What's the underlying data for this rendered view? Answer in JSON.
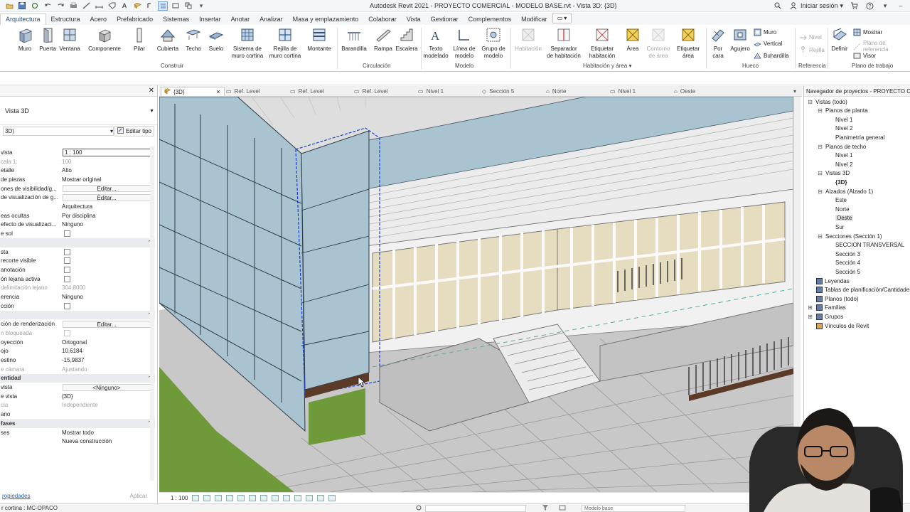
{
  "window": {
    "title": "Autodesk Revit 2021 - PROYECTO COMERCIAL - MODELO BASE.rvt - Vista 3D: {3D}",
    "sign_in": "Iniciar sesión"
  },
  "ribbon_tabs": [
    {
      "label": "Arquitectura",
      "active": true
    },
    {
      "label": "Estructura"
    },
    {
      "label": "Acero"
    },
    {
      "label": "Prefabricado"
    },
    {
      "label": "Sistemas"
    },
    {
      "label": "Insertar"
    },
    {
      "label": "Anotar"
    },
    {
      "label": "Analizar"
    },
    {
      "label": "Masa y emplazamiento"
    },
    {
      "label": "Colaborar"
    },
    {
      "label": "Vista"
    },
    {
      "label": "Gestionar"
    },
    {
      "label": "Complementos"
    },
    {
      "label": "Modificar"
    }
  ],
  "ribbon": {
    "construir": {
      "label": "Construir",
      "tools": [
        {
          "label": "Muro",
          "icon": "wall-icon"
        },
        {
          "label": "Puerta",
          "icon": "door-icon"
        },
        {
          "label": "Ventana",
          "icon": "window-icon"
        },
        {
          "label": "Componente",
          "icon": "component-icon"
        },
        {
          "label": "Pilar",
          "icon": "column-icon"
        },
        {
          "label": "Cubierta",
          "icon": "roof-icon"
        },
        {
          "label": "Techo",
          "icon": "ceiling-icon"
        },
        {
          "label": "Suelo",
          "icon": "floor-icon"
        },
        {
          "label": "Sistema de\nmuro cortina",
          "icon": "curtain-system-icon"
        },
        {
          "label": "Rejilla de\nmuro cortina",
          "icon": "curtain-grid-icon"
        },
        {
          "label": "Montante",
          "icon": "mullion-icon"
        }
      ]
    },
    "circulacion": {
      "label": "Circulación",
      "tools": [
        {
          "label": "Barandilla",
          "icon": "railing-icon"
        },
        {
          "label": "Rampa",
          "icon": "ramp-icon"
        },
        {
          "label": "Escalera",
          "icon": "stair-icon"
        }
      ]
    },
    "modelo": {
      "label": "Modelo",
      "tools": [
        {
          "label": "Texto\nmodelado",
          "icon": "model-text-icon"
        },
        {
          "label": "Línea de\nmodelo",
          "icon": "model-line-icon"
        },
        {
          "label": "Grupo de\nmodelo",
          "icon": "model-group-icon"
        }
      ]
    },
    "habitacion": {
      "label": "Habitación y área",
      "tools": [
        {
          "label": "Habitación",
          "icon": "room-icon",
          "disabled": true
        },
        {
          "label": "Separador\nde habitación",
          "icon": "room-separator-icon"
        },
        {
          "label": "Etiquetar\nhabitación",
          "icon": "tag-room-icon"
        },
        {
          "label": "Área",
          "icon": "area-icon"
        },
        {
          "label": "Contorno\nde área",
          "icon": "area-boundary-icon",
          "disabled": true
        },
        {
          "label": "Etiquetar\nárea",
          "icon": "tag-area-icon"
        }
      ]
    },
    "hueco": {
      "label": "Hueco",
      "tools": [
        {
          "label": "Por\ncara",
          "icon": "by-face-icon"
        },
        {
          "label": "Agujero",
          "icon": "shaft-icon"
        }
      ],
      "small": [
        {
          "label": "Muro",
          "icon": "wall-opening-icon"
        },
        {
          "label": "Vertical",
          "icon": "vertical-opening-icon"
        },
        {
          "label": "Buhardilla",
          "icon": "dormer-icon"
        }
      ]
    },
    "referencia": {
      "label": "Referencia",
      "small": [
        {
          "label": "Nivel",
          "icon": "level-icon",
          "disabled": true
        },
        {
          "label": "Rejilla",
          "icon": "grid-icon",
          "disabled": true
        }
      ]
    },
    "plano": {
      "label": "Plano de trabajo",
      "tools": [
        {
          "label": "Definir",
          "icon": "set-workplane-icon"
        }
      ],
      "small": [
        {
          "label": "Mostrar",
          "icon": "show-workplane-icon"
        },
        {
          "label": "Plano de referencia",
          "icon": "ref-plane-icon",
          "disabled": true
        },
        {
          "label": "Visor",
          "icon": "viewer-icon"
        }
      ]
    }
  },
  "properties": {
    "type_name": "Vista 3D",
    "filter_value": "3D)",
    "edit_type": "Editar tipo",
    "rows": [
      {
        "k": "vista",
        "v": "1 : 100",
        "kind": "input"
      },
      {
        "k": "cala   1:",
        "v": "100",
        "kdis": true,
        "vdis": true
      },
      {
        "k": "etalle",
        "v": "Alto"
      },
      {
        "k": "de piezas",
        "v": "Mostrar original"
      },
      {
        "k": "ones de visibilidad/g...",
        "v": "Editar...",
        "kind": "button"
      },
      {
        "k": "de visualización de g...",
        "v": "Editar...",
        "kind": "button"
      },
      {
        "k": "",
        "v": "Arquitectura"
      },
      {
        "k": "eas ocultas",
        "v": "Por disciplina"
      },
      {
        "k": "efecto de visualizaci...",
        "v": "Ninguno"
      },
      {
        "k": "e sol",
        "v": "",
        "kind": "check"
      },
      {
        "k": "",
        "v": "",
        "kind": "section"
      },
      {
        "k": "sta",
        "v": "",
        "kind": "check"
      },
      {
        "k": "recorte visible",
        "v": "",
        "kind": "check"
      },
      {
        "k": "anotación",
        "v": "",
        "kind": "check"
      },
      {
        "k": "ón lejana activa",
        "v": "",
        "kind": "check"
      },
      {
        "k": "delimitación lejano",
        "v": "304,8000",
        "kdis": true,
        "vdis": true
      },
      {
        "k": "erencia",
        "v": "Ninguno"
      },
      {
        "k": "cción",
        "v": "",
        "kind": "check"
      },
      {
        "k": "",
        "v": "",
        "kind": "section"
      },
      {
        "k": "ción de renderización",
        "v": "Editar...",
        "kind": "button"
      },
      {
        "k": "n bloqueada",
        "v": "",
        "kind": "check",
        "kdis": true
      },
      {
        "k": "oyección",
        "v": "Ortogonal"
      },
      {
        "k": "ojo",
        "v": "10,6184"
      },
      {
        "k": "estino",
        "v": "-15,9837"
      },
      {
        "k": "e cámara",
        "v": "Ajustando",
        "kdis": true,
        "vdis": true
      },
      {
        "k": "entidad",
        "v": "",
        "kind": "section"
      },
      {
        "k": "vista",
        "v": "<Ninguno>",
        "kind": "button"
      },
      {
        "k": "e vista",
        "v": "{3D}"
      },
      {
        "k": "cia",
        "v": "Independiente",
        "kdis": true,
        "vdis": true
      },
      {
        "k": "ano",
        "v": ""
      },
      {
        "k": "fases",
        "v": "",
        "kind": "section"
      },
      {
        "k": "ses",
        "v": "Mostrar todo"
      },
      {
        "k": "",
        "v": "Nueva construcción"
      }
    ],
    "footer_link": "ropiedades",
    "apply": "Aplicar"
  },
  "doc_tabs": [
    {
      "label": "{3D}",
      "active": true
    },
    {
      "label": "Ref. Level"
    },
    {
      "label": "Ref. Level"
    },
    {
      "label": "Ref. Level"
    },
    {
      "label": "Nivel 1"
    },
    {
      "label": "Sección 5"
    },
    {
      "label": "Norte"
    },
    {
      "label": "Nivel 1"
    },
    {
      "label": "Oeste"
    }
  ],
  "view_bar": {
    "scale": "1 : 100"
  },
  "browser": {
    "title": "Navegador de proyectos - PROYECTO C",
    "nodes": [
      {
        "label": "Vistas (todo)",
        "depth": 0,
        "exp": "-"
      },
      {
        "label": "Planos de planta",
        "depth": 1,
        "exp": "-"
      },
      {
        "label": "Nivel 1",
        "depth": 2
      },
      {
        "label": "Nivel 2",
        "depth": 2
      },
      {
        "label": "Planimetría general",
        "depth": 2
      },
      {
        "label": "Planos de techo",
        "depth": 1,
        "exp": "-"
      },
      {
        "label": "Nivel 1",
        "depth": 2
      },
      {
        "label": "Nivel 2",
        "depth": 2
      },
      {
        "label": "Vistas 3D",
        "depth": 1,
        "exp": "-"
      },
      {
        "label": "{3D}",
        "depth": 2,
        "bold": true
      },
      {
        "label": "Alzados (Alzado 1)",
        "depth": 1,
        "exp": "-"
      },
      {
        "label": "Este",
        "depth": 2
      },
      {
        "label": "Norte",
        "depth": 2
      },
      {
        "label": "Oeste",
        "depth": 2,
        "sel": true
      },
      {
        "label": "Sur",
        "depth": 2
      },
      {
        "label": "Secciones (Sección 1)",
        "depth": 1,
        "exp": "-"
      },
      {
        "label": "SECCION TRANSVERSAL",
        "depth": 2
      },
      {
        "label": "Sección 3",
        "depth": 2
      },
      {
        "label": "Sección 4",
        "depth": 2
      },
      {
        "label": "Sección 5",
        "depth": 2
      },
      {
        "label": "Leyendas",
        "depth": 0,
        "icon": "legend-icon"
      },
      {
        "label": "Tablas de planificación/Cantidades",
        "depth": 0,
        "icon": "schedule-icon"
      },
      {
        "label": "Planos (todo)",
        "depth": 0,
        "icon": "sheets-icon"
      },
      {
        "label": "Familias",
        "depth": 0,
        "exp": "+",
        "icon": "family-icon"
      },
      {
        "label": "Grupos",
        "depth": 0,
        "exp": "+",
        "icon": "group-icon"
      },
      {
        "label": "Vínculos de Revit",
        "depth": 0,
        "icon": "link-icon"
      }
    ]
  },
  "status": {
    "message": "r cortina : MC-OPACO",
    "model": "Modelo base"
  },
  "colors": {
    "accent": "#1a4f8f",
    "glass": "#a9c4d0",
    "floor_tile": "#bdbdbd",
    "grass": "#6f9a3a",
    "selection": "#1a3fd6",
    "wood": "#5b3a28"
  }
}
